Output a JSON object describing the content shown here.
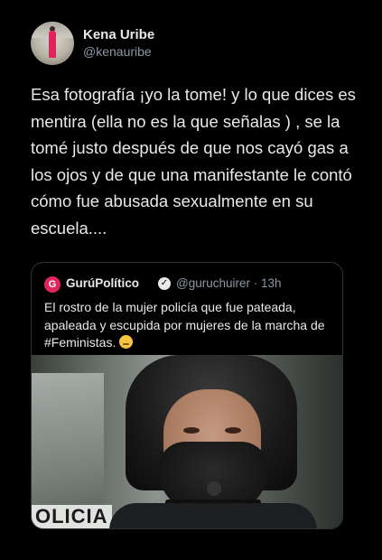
{
  "tweet": {
    "author_name": "Kena Uribe",
    "author_handle": "@kenauribe",
    "text": "Esa fotografía  ¡yo la tome! y lo que dices es mentira (ella no es la que señalas ) , se la tomé justo después de que nos cayó gas a los ojos y de que una manifestante le contó cómo fue abusada sexualmente en su escuela...."
  },
  "quoted_tweet": {
    "avatar_glyph": "G",
    "author_name": "GurúPolítico",
    "author_handle": "@guruchuirer · 13h",
    "text": "El rostro de la mujer policía que fue pateada, apaleada y escupida por mujeres de la marcha de #Feministas.",
    "emoji": "pensive-face",
    "photo_text": "OLICIA"
  },
  "colors": {
    "background": "#000000",
    "text": "#e7e9ea",
    "secondary_text": "#8b98a5",
    "border": "#2f3336"
  }
}
